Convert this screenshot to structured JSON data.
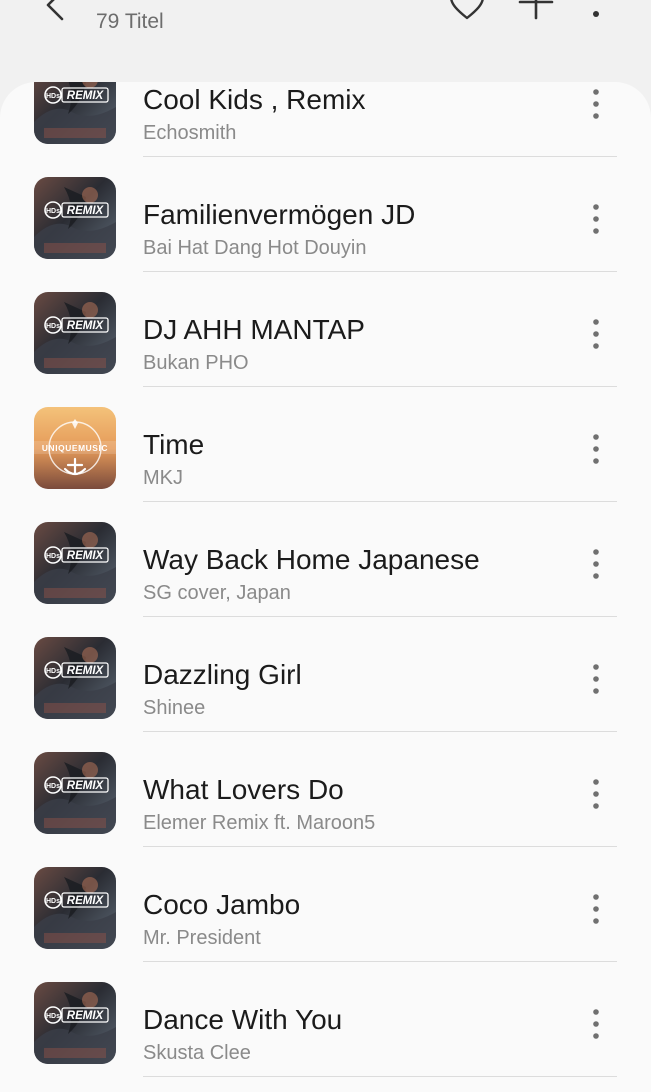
{
  "header": {
    "count_label": "79 Titel",
    "icons": [
      "back-arrow-icon",
      "heart-icon",
      "plus-icon",
      "more-vertical-icon"
    ]
  },
  "thumbnails": {
    "remix": {
      "label": "REMIX",
      "badge": "HDs"
    },
    "unique": {
      "label": "UNIQUEMUSIC"
    }
  },
  "tracks": [
    {
      "title": "Cool Kids , Remix",
      "artist": "Echosmith",
      "art": "remix"
    },
    {
      "title": "Familienvermögen JD",
      "artist": "Bai Hat Dang Hot Douyin",
      "art": "remix"
    },
    {
      "title": "DJ AHH MANTAP",
      "artist": "Bukan PHO",
      "art": "remix"
    },
    {
      "title": "Time",
      "artist": "MKJ",
      "art": "unique"
    },
    {
      "title": "Way Back Home Japanese",
      "artist": "SG cover, Japan",
      "art": "remix"
    },
    {
      "title": "Dazzling Girl",
      "artist": "Shinee",
      "art": "remix"
    },
    {
      "title": "What Lovers Do",
      "artist": "Elemer Remix ft. Maroon5",
      "art": "remix"
    },
    {
      "title": "Coco Jambo",
      "artist": "Mr. President",
      "art": "remix"
    },
    {
      "title": "Dance With You",
      "artist": "Skusta Clee",
      "art": "remix"
    }
  ]
}
